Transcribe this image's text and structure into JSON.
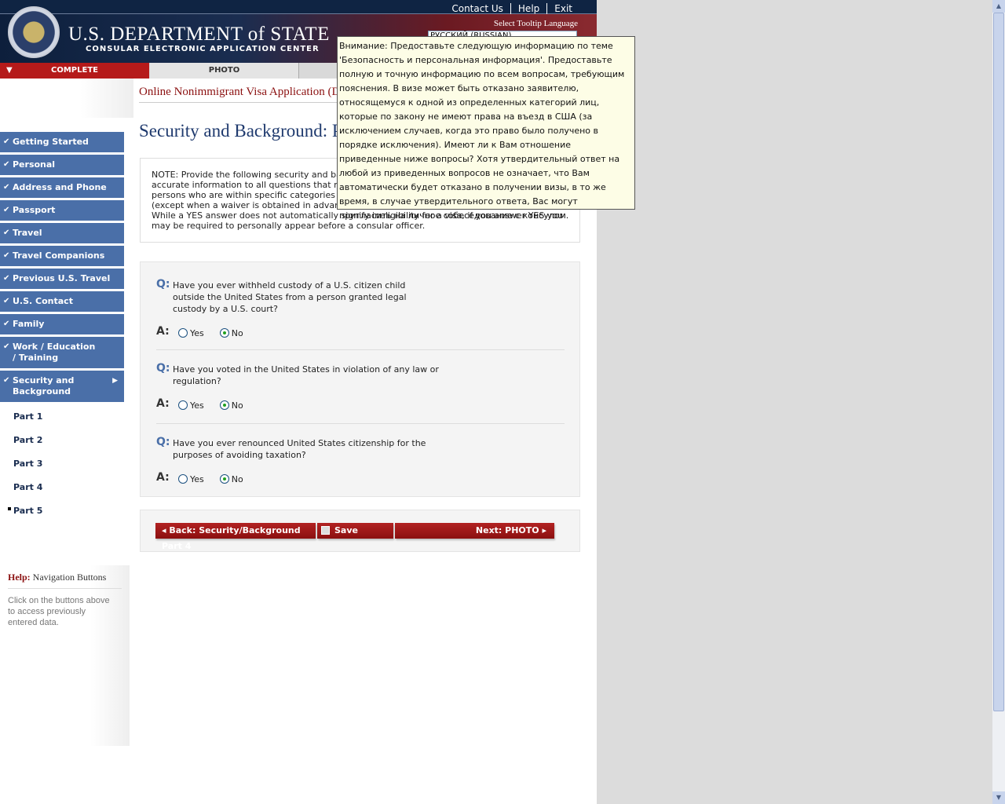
{
  "header": {
    "links": [
      "Contact Us",
      "Help",
      "Exit"
    ],
    "dept": "U.S. DEPARTMENT of STATE",
    "subtitle": "CONSULAR ELECTRONIC APPLICATION CENTER",
    "tooltip_language_label": "Select Tooltip Language",
    "tooltip_language_value": "РУССКИЙ (RUSSIAN)"
  },
  "tabs": [
    "COMPLETE",
    "PHOTO"
  ],
  "app_title": "Online Nonimmigrant Visa Application (DS-160)",
  "page_title": "Security and Background: Part 5",
  "sidebar": {
    "items": [
      "Getting Started",
      "Personal",
      "Address and Phone",
      "Passport",
      "Travel",
      "Travel Companions",
      "Previous U.S. Travel",
      "U.S. Contact",
      "Family",
      "Work / Education / Training",
      "Security and Background"
    ],
    "subitems": [
      "Part 1",
      "Part 2",
      "Part 3",
      "Part 4",
      "Part 5"
    ]
  },
  "help": {
    "label": "Help:",
    "title": "Navigation Buttons",
    "text": "Click on the buttons above to access previously entered data."
  },
  "note": "NOTE: Provide the following security and background information. Provide complete and accurate information to all questions that require an explanation. A visa may not be issued to persons who are within specific categories defined by law as inadmissible to the United States (except when a waiver is obtained in advance). Are any of the following applicable to you? While a YES answer does not automatically signify ineligibility for a visa, if you answer YES you may be required to personally appear before a consular officer.",
  "questions": [
    {
      "q": "Have you ever withheld custody of a U.S. citizen child outside the United States from a person granted legal custody by a U.S. court?",
      "answer": "No"
    },
    {
      "q": "Have you voted in the United States in violation of any law or regulation?",
      "answer": "No"
    },
    {
      "q": "Have you ever renounced United States citizenship for the purposes of avoiding taxation?",
      "answer": "No"
    }
  ],
  "labels": {
    "q": "Q:",
    "a": "A:",
    "yes": "Yes",
    "no": "No"
  },
  "buttons": {
    "back": "Back: Security/Background Part 4",
    "save": "Save",
    "next": "Next: PHOTO"
  },
  "tooltip": "Внимание: Предоставьте следующую информацию по теме 'Безопасность и персональная информация'. Предоставьте полную и точную информацию по всем вопросам, требующим пояснения. В визе может быть отказано заявителю, относящемуся к одной из определенных категорий лиц, которые по закону не имеют права на въезд в США (за исключением случаев, когда это право было получено в порядке исключения). Имеют ли к Вам отношение приведенные ниже вопросы? Хотя утвердительный ответ на любой из приведенных вопросов не означает, что Вам автоматически будет отказано в получении визы, в то же время, в случае утвердительного ответа, Вас могут пригласить на личное собеседование с консулом."
}
